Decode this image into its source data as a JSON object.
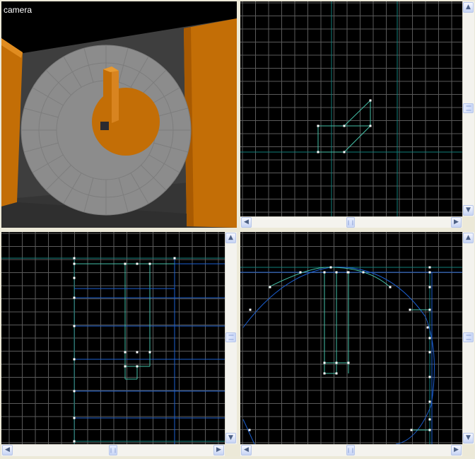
{
  "camera": {
    "label": "camera"
  },
  "icons": {
    "up": "▲",
    "down": "▼",
    "left": "◀",
    "right": "▶"
  },
  "colors": {
    "background": "#000000",
    "grid_minor": "#5a5a5a",
    "grid_major": "#0f7f7a",
    "axis": "#1b5fd0",
    "brush_selected": "#44c1a8",
    "vertex": "#ffffff",
    "wood": "#c36e06",
    "gray_disc": "#8a8a8a"
  }
}
